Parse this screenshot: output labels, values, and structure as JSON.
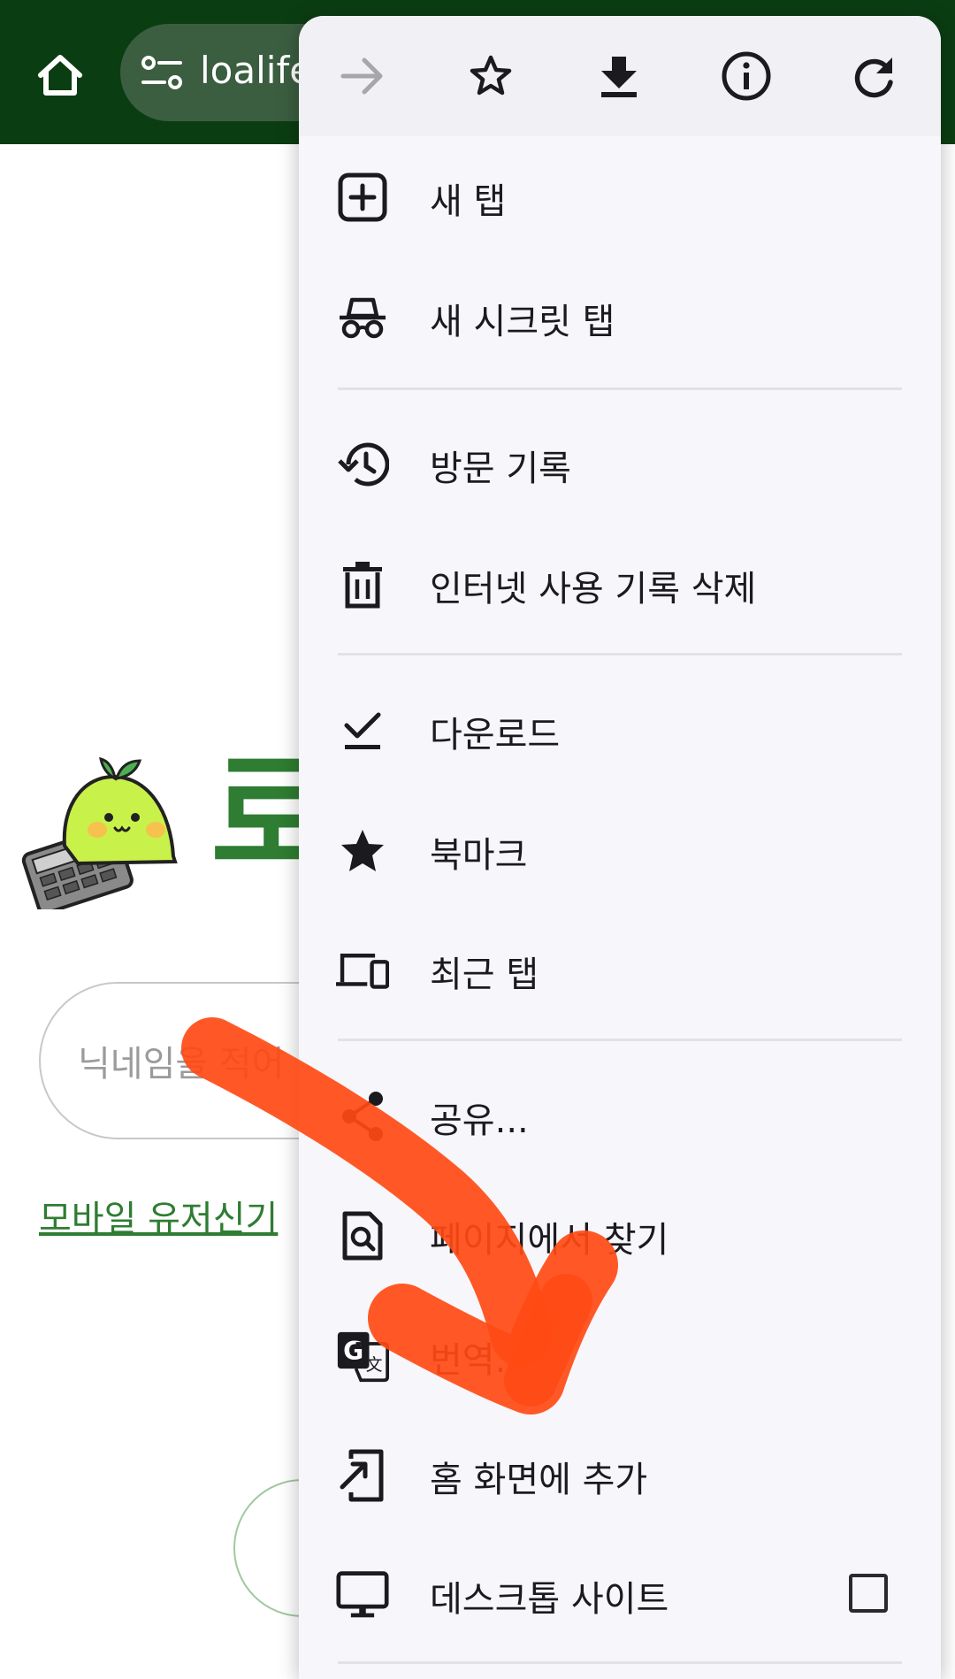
{
  "browser": {
    "url_text": "loalife"
  },
  "page": {
    "title_fragment": "로",
    "nickname_placeholder": "닉네임을 적어",
    "mobile_link": "모바일 유저신기"
  },
  "menu": {
    "toolbar": [
      "forward-icon",
      "bookmark-star-icon",
      "download-icon",
      "info-icon",
      "reload-icon"
    ],
    "items": [
      {
        "label": "새 탭",
        "icon": "new-tab-icon"
      },
      {
        "label": "새 시크릿 탭",
        "icon": "incognito-icon"
      },
      {
        "label": "방문 기록",
        "icon": "history-icon"
      },
      {
        "label": "인터넷 사용 기록 삭제",
        "icon": "trash-icon"
      },
      {
        "label": "다운로드",
        "icon": "downloads-icon"
      },
      {
        "label": "북마크",
        "icon": "star-filled-icon"
      },
      {
        "label": "최근 탭",
        "icon": "devices-icon"
      },
      {
        "label": "공유...",
        "icon": "share-icon"
      },
      {
        "label": "페이지에서 찾기",
        "icon": "find-in-page-icon"
      },
      {
        "label": "번역...",
        "icon": "translate-icon"
      },
      {
        "label": "홈 화면에 추가",
        "icon": "add-to-home-icon"
      },
      {
        "label": "데스크톱 사이트",
        "icon": "desktop-icon",
        "checked": false
      }
    ]
  },
  "colors": {
    "topbar": "#0b3d12",
    "brand_green": "#2e7d32",
    "annotation_arrow": "#ff4a14"
  }
}
